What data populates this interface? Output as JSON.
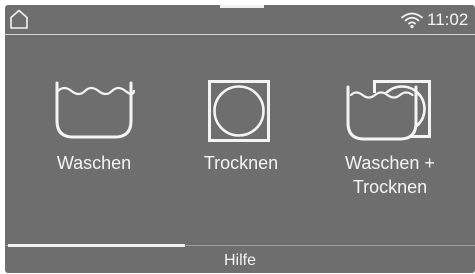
{
  "status": {
    "home_icon": "home-icon",
    "wifi_icon": "wifi-icon",
    "time": "11:02"
  },
  "programs": [
    {
      "icon": "wash-tub-icon",
      "label": "Waschen"
    },
    {
      "icon": "tumble-dry-icon",
      "label": "Trocknen"
    },
    {
      "icon": "wash-and-dry-icon",
      "label_line1": "Waschen +",
      "label_line2": "Trocknen"
    }
  ],
  "footer": {
    "help_label": "Hilfe"
  },
  "colors": {
    "panel_background": "#6e6e6e",
    "foreground": "#f4f4f4",
    "divider": "#d4d4d4"
  }
}
